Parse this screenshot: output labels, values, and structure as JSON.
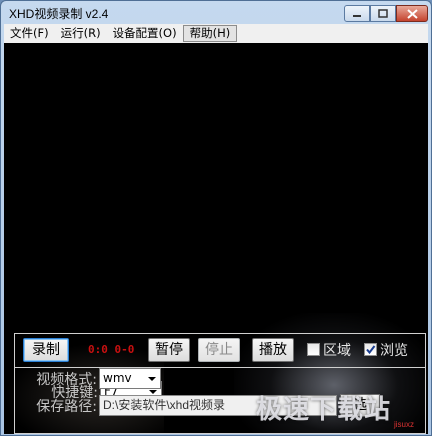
{
  "window": {
    "title": "XHD视频录制 v2.4"
  },
  "menu": {
    "items": [
      "文件(F)",
      "运行(R)",
      "设备配置(O)",
      "帮助(H)"
    ]
  },
  "controls": {
    "record_label": "录制",
    "timer": "0:0 0-0",
    "pause_label": "暂停",
    "stop_label": "停止",
    "play_label": "播放",
    "region_label": "区域",
    "region_checked": false,
    "browse_label": "浏览",
    "browse_checked": true
  },
  "settings": {
    "hotkey_label": "快捷键:",
    "hotkey_value": "F7",
    "format_label": "视频格式:",
    "format_value": "wmv",
    "path_label": "保存路径:",
    "path_value": "D:\\安装软件\\xhd视频录",
    "select_label": "选"
  },
  "watermark": {
    "text": "极速下载站",
    "sub": "jisuxz"
  },
  "colors": {
    "timer": "#c81010",
    "focus_border": "#2a7fd4",
    "close_button": "#c4432e"
  }
}
